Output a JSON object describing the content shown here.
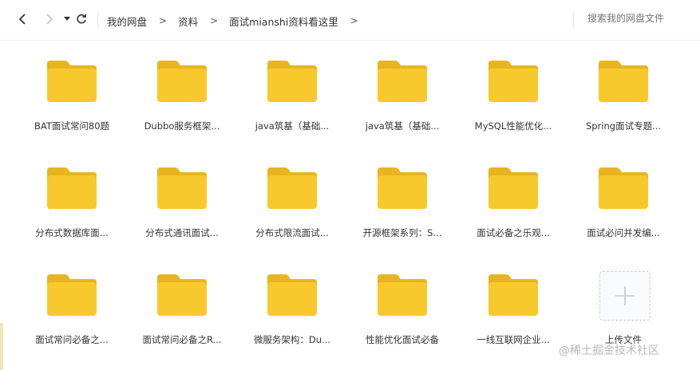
{
  "toolbar": {
    "breadcrumbs": [
      "我的网盘",
      "资料",
      "面试mianshi资料看这里"
    ],
    "search_placeholder": "搜索我的网盘文件"
  },
  "folders": [
    {
      "label": "BAT面试常问80题"
    },
    {
      "label": "Dubbo服务框架..."
    },
    {
      "label": "java筑基（基础..."
    },
    {
      "label": "java筑基（基础..."
    },
    {
      "label": "MySQL性能优化..."
    },
    {
      "label": "Spring面试专题..."
    },
    {
      "label": "分布式数据库面..."
    },
    {
      "label": "分布式通讯面试..."
    },
    {
      "label": "分布式限流面试..."
    },
    {
      "label": "开源框架系列：S..."
    },
    {
      "label": "面试必备之乐观..."
    },
    {
      "label": "面试必问并发编..."
    },
    {
      "label": "面试常问必备之..."
    },
    {
      "label": "面试常问必备之R..."
    },
    {
      "label": "微服务架构：Du..."
    },
    {
      "label": "性能优化面试必备"
    },
    {
      "label": "一线互联网企业..."
    }
  ],
  "upload": {
    "label": "上传文件"
  },
  "watermark": "@稀土掘金技术社区",
  "colors": {
    "folder": "#f8c92c",
    "folder_tab": "#e8b520",
    "accent": "#06a7ff"
  }
}
